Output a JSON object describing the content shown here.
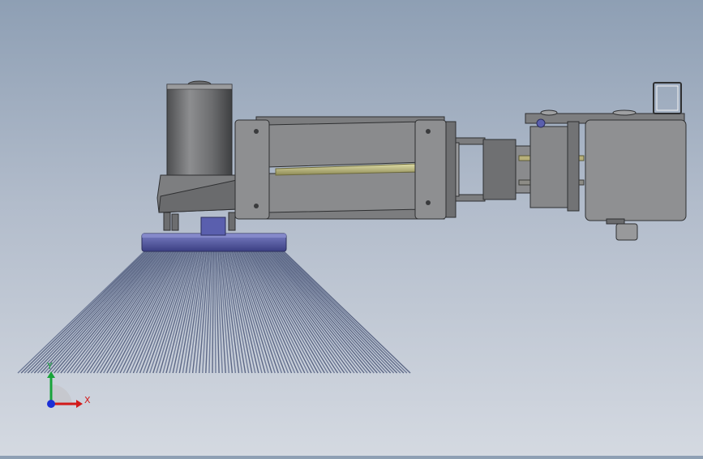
{
  "viewport": {
    "colors": {
      "background_top": "#8e9fb4",
      "background_bottom": "#d4d9e1",
      "steel": "#8c8d8f",
      "steel_dark": "#5e5f61",
      "brush_hub": "#4b4f9a",
      "bristles": "#6f7b98",
      "spring": "#b8b57a"
    }
  },
  "triad": {
    "x_label": "X",
    "y_label": "Y",
    "x_color": "#d21a1a",
    "y_color": "#18a33a",
    "z_color": "#1b2fd6"
  }
}
